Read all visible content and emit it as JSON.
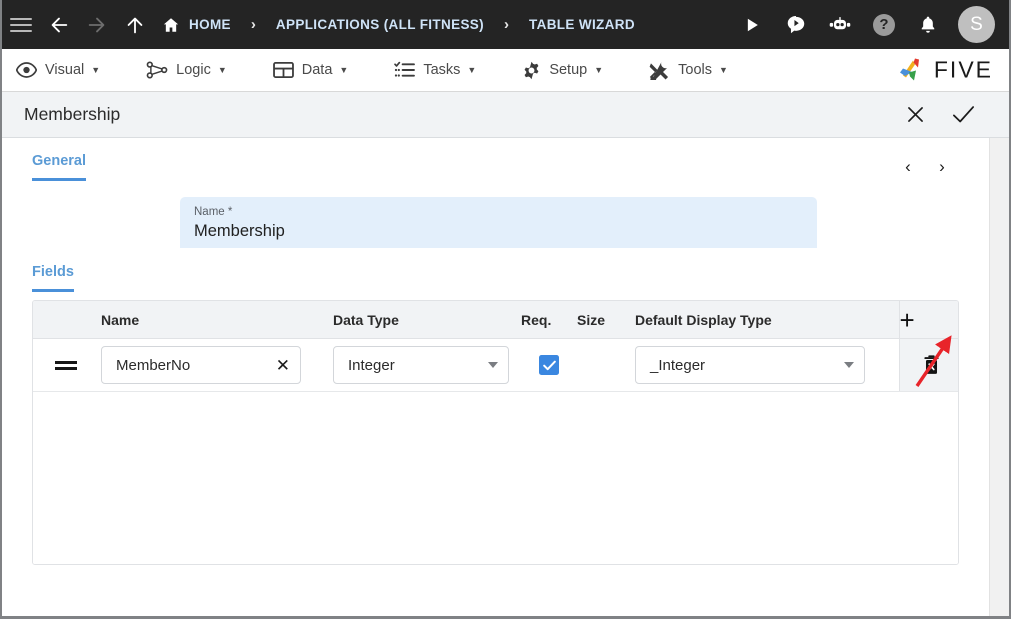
{
  "topbar": {
    "menu_icon": "hamburger-icon",
    "back_icon": "arrow-left-icon",
    "forward_icon": "arrow-right-icon",
    "up_icon": "arrow-up-icon",
    "home_icon": "home-icon",
    "breadcrumbs": [
      {
        "label": "HOME",
        "has_icon": true
      },
      {
        "label": "APPLICATIONS (ALL FITNESS)",
        "has_icon": false
      },
      {
        "label": "TABLE WIZARD",
        "has_icon": false
      }
    ],
    "separator": "›",
    "actions": [
      {
        "name": "run-button",
        "icon": "play-icon"
      },
      {
        "name": "chat-button",
        "icon": "chat-play-icon"
      },
      {
        "name": "assistant-button",
        "icon": "robot-icon"
      },
      {
        "name": "help-button",
        "icon": "help-icon",
        "glyph": "?"
      },
      {
        "name": "notifications-button",
        "icon": "bell-icon"
      }
    ],
    "avatar_initial": "S",
    "background": "#242424",
    "accent_color": "#f5c431"
  },
  "menubar": {
    "items": [
      {
        "label": "Visual",
        "icon": "eye-icon"
      },
      {
        "label": "Logic",
        "icon": "flow-nodes-icon"
      },
      {
        "label": "Data",
        "icon": "table-icon"
      },
      {
        "label": "Tasks",
        "icon": "checklist-icon"
      },
      {
        "label": "Setup",
        "icon": "gear-icon"
      },
      {
        "label": "Tools",
        "icon": "tools-icon"
      }
    ],
    "caret": "▼",
    "brand": "FIVE"
  },
  "titlebar": {
    "title": "Membership",
    "close_label": "✕",
    "confirm_label": "✓"
  },
  "general": {
    "tab_label": "General",
    "prev_arrow": "‹",
    "next_arrow": "›",
    "name_label": "Name *",
    "name_value": "Membership"
  },
  "fields": {
    "tab_label": "Fields",
    "columns": [
      "",
      "Name",
      "Data Type",
      "Req.",
      "Size",
      "Default Display Type",
      ""
    ],
    "add_button": "+",
    "rows": [
      {
        "handle": "drag-handle-icon",
        "name": "MemberNo",
        "clear": "✕",
        "data_type": "Integer",
        "required": true,
        "size": "",
        "default_display_type": "_Integer",
        "delete": "trash-icon"
      }
    ]
  },
  "annotation": {
    "arrow_color": "#e8242a",
    "points_to": "add-field-button"
  }
}
